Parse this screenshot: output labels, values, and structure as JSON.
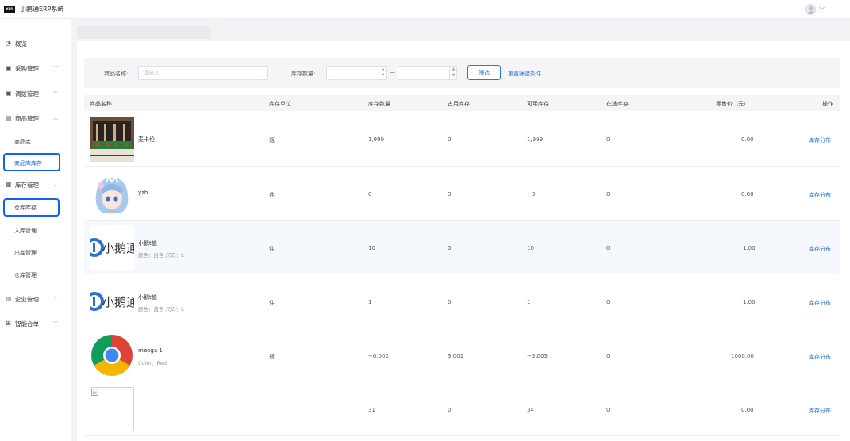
{
  "header": {
    "logo_text": "XED",
    "app_title": "小鹏通ERP系统"
  },
  "sidebar": {
    "overview": "概览",
    "purchase": "采购管理",
    "transfer": "调拨管理",
    "goods": "商品管理",
    "goods_sub": [
      "商品库",
      "商品库库存"
    ],
    "inventory": "库存管理",
    "inventory_sub": [
      "仓库库存",
      "入库管理",
      "出库管理",
      "仓库管理"
    ],
    "enterprise": "企业管理",
    "smart": "智能合单"
  },
  "filter": {
    "name_label": "商品名称:",
    "name_placeholder": "请输入",
    "qty_label": "库存数量:",
    "dash": "—",
    "filter_button": "筛选",
    "reset_link": "重置筛选条件"
  },
  "table": {
    "headers": [
      "商品名称",
      "库存单位",
      "库存数量",
      "占用库存",
      "可用库存",
      "在途库存",
      "零售价（元）",
      "操作"
    ],
    "rows": [
      {
        "name": "麦卡伦",
        "spec": "",
        "unit": "瓶",
        "qty": "1,999",
        "occupied": "0",
        "available": "1,999",
        "transit": "0",
        "price": "0.00",
        "action": "库存分布",
        "thumb": "bottles"
      },
      {
        "name": "yzh",
        "spec": "",
        "unit": "件",
        "qty": "0",
        "occupied": "3",
        "available": "−3",
        "transit": "0",
        "price": "0.00",
        "action": "库存分布",
        "thumb": "anime"
      },
      {
        "name": "小鹅t恤",
        "spec": "颜色：白色 尺码：L",
        "unit": "件",
        "qty": "10",
        "occupied": "0",
        "available": "10",
        "transit": "0",
        "price": "1.00",
        "action": "库存分布",
        "thumb": "xiaoe",
        "thumb_text": "小鹅通"
      },
      {
        "name": "小鹅t恤",
        "spec": "颜色：蓝色 尺码：L",
        "unit": "件",
        "qty": "1",
        "occupied": "0",
        "available": "1",
        "transit": "0",
        "price": "1.00",
        "action": "库存分布",
        "thumb": "xiaoe",
        "thumb_text": "小鹅通"
      },
      {
        "name": "meoga 1",
        "spec": "Color：Red",
        "unit": "瓶",
        "qty": "−0.002",
        "occupied": "3.001",
        "available": "−3.003",
        "transit": "0",
        "price": "1000.00",
        "action": "库存分布",
        "thumb": "chrome"
      },
      {
        "name": "",
        "spec": "",
        "unit": "",
        "qty": "31",
        "occupied": "0",
        "available": "34",
        "transit": "0",
        "price": "0.00",
        "action": "库存分布",
        "thumb": "broken"
      }
    ]
  }
}
